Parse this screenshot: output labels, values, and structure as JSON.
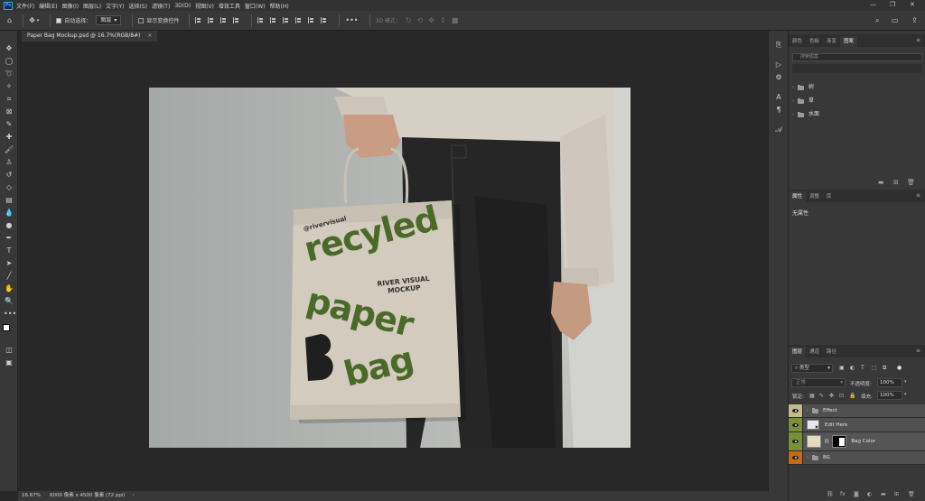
{
  "app": {
    "logo": "Ps"
  },
  "menu": [
    "文件(F)",
    "编辑(E)",
    "图像(I)",
    "图层(L)",
    "文字(Y)",
    "选择(S)",
    "滤镜(T)",
    "3D(D)",
    "视图(V)",
    "增效工具",
    "窗口(W)",
    "帮助(H)"
  ],
  "options": {
    "auto_select_label": "自动选择：",
    "auto_select_value": "图层",
    "show_transform_label": "显示变换控件",
    "mode_3d_label": "3D 模式："
  },
  "document": {
    "tab_title": "Paper Bag Mockup.psd @ 16.7%(RGB/8#)",
    "tab_close": "×"
  },
  "bag": {
    "handle_text": "@rivervisual",
    "word1": "recyled",
    "word2": "paper",
    "word3": "bag",
    "brand_line1": "RIVER VISUAL",
    "brand_line2": "MOCKUP"
  },
  "swatch_panel": {
    "tabs": [
      "颜色",
      "色板",
      "渐变",
      "图案"
    ],
    "active_tab": "图案",
    "search_placeholder": "搜索图案",
    "groups": [
      "树",
      "草",
      "水面"
    ]
  },
  "properties_panel": {
    "tabs": [
      "属性",
      "调整",
      "库"
    ],
    "active_tab": "属性",
    "empty_text": "无属性"
  },
  "layers_panel": {
    "tabs": [
      "图层",
      "通道",
      "路径"
    ],
    "active_tab": "图层",
    "filter_label": "类型",
    "blend_mode": "正常",
    "opacity_label": "不透明度:",
    "opacity_value": "100%",
    "lock_label": "锁定:",
    "fill_label": "填充:",
    "fill_value": "100%",
    "layers": [
      {
        "name": "Effect",
        "type": "group",
        "eye_color": "#c5b98d"
      },
      {
        "name": "Edit Here",
        "type": "smart",
        "eye_color": "#7a8f3c"
      },
      {
        "name": "Bag Color",
        "type": "fill",
        "eye_color": "#7a8f3c"
      },
      {
        "name": "BG",
        "type": "group",
        "eye_color": "#c46a1c"
      }
    ]
  },
  "status": {
    "zoom": "16.67%",
    "doc_info": "6000 像素 x 4500 像素 (72 ppi)",
    "arrow": "›"
  },
  "colors": {
    "bag": "#d3cbbd",
    "bag_text": "#4b6a2a",
    "brand_text": "#2f2f2f",
    "photoshop_blue": "#31a8ff"
  }
}
